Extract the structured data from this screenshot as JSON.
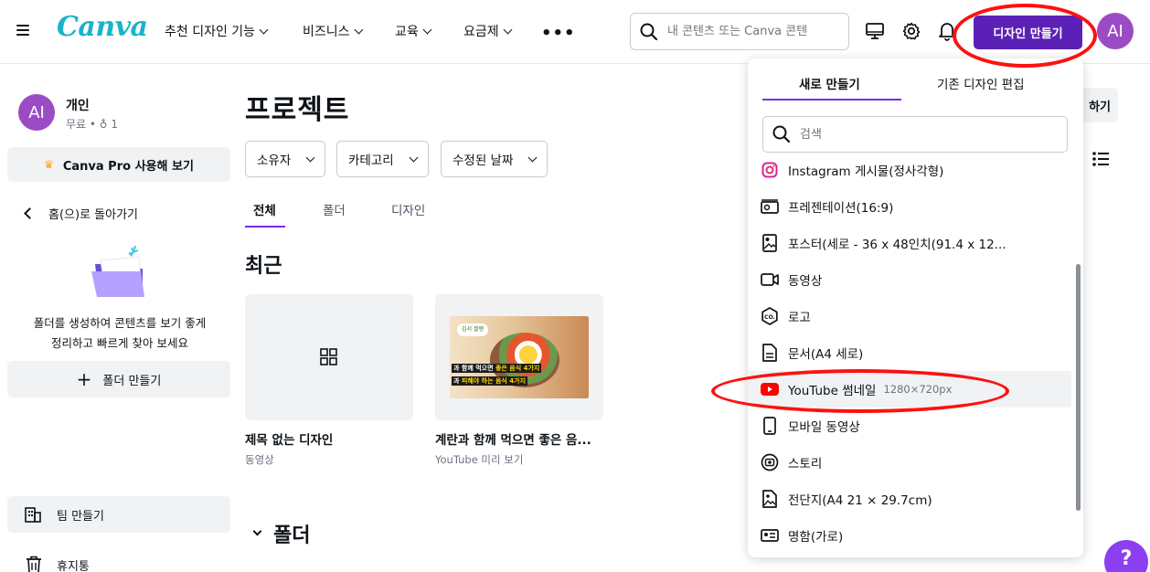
{
  "header": {
    "logo": "Canva",
    "nav": [
      {
        "label": "추천 디자인 기능"
      },
      {
        "label": "비즈니스"
      },
      {
        "label": "교육"
      },
      {
        "label": "요금제"
      }
    ],
    "search_placeholder": "내 콘텐츠 또는 Canva 콘텐",
    "create_button": "디자인 만들기",
    "avatar_initials": "AI"
  },
  "sidebar": {
    "profile": {
      "initials": "AI",
      "name": "개인",
      "plan": "무료 • ",
      "members": "1"
    },
    "pro_button": "Canva Pro 사용해 보기",
    "back_link": "홈(으)로 돌아가기",
    "folder_desc_line1": "폴더를 생성하여 콘텐츠를 보기 좋게",
    "folder_desc_line2": "정리하고 빠르게 찾아 보세요",
    "create_folder": "폴더 만들기",
    "create_team": "팀 만들기",
    "trash": "휴지통"
  },
  "main": {
    "title": "프로젝트",
    "filters": [
      "소유자",
      "카테고리",
      "수정된 날짜"
    ],
    "tabs": [
      "전체",
      "폴더",
      "디자인"
    ],
    "recent_title": "최근",
    "folders_title": "폴더",
    "share_button_partial": "하기",
    "cards": [
      {
        "title": "제목 없는 디자인",
        "subtitle": "동영상"
      },
      {
        "title": "계란과 함께 먹으면 좋은 음...",
        "subtitle": "YouTube 미리 보기",
        "thumb_badge": "김서 셀렝",
        "thumb_line1a": "과 함께 먹으면 ",
        "thumb_line1b": "좋은 음식 4가지",
        "thumb_line2a": "과 ",
        "thumb_line2b": "피해야 하는 음식 4가지"
      }
    ]
  },
  "dropdown": {
    "tabs": [
      "새로 만들기",
      "기존 디자인 편집"
    ],
    "search_placeholder": "검색",
    "items": [
      {
        "label": "Instagram 게시물(정사각형)",
        "icon": "instagram-icon"
      },
      {
        "label": "프레젠테이션(16:9)",
        "icon": "presentation-icon"
      },
      {
        "label": "포스터(세로 - 36 x 48인치(91.4 x 12...",
        "icon": "poster-icon"
      },
      {
        "label": "동영상",
        "icon": "video-icon"
      },
      {
        "label": "로고",
        "icon": "logo-icon"
      },
      {
        "label": "문서(A4 세로)",
        "icon": "document-icon"
      },
      {
        "label": "YouTube 썸네일",
        "size": "1280×720px",
        "icon": "youtube-icon"
      },
      {
        "label": "모바일 동영상",
        "icon": "mobile-video-icon"
      },
      {
        "label": "스토리",
        "icon": "story-icon"
      },
      {
        "label": "전단지(A4 21 × 29.7cm)",
        "icon": "flyer-icon"
      },
      {
        "label": "명함(가로)",
        "icon": "business-card-icon"
      }
    ]
  },
  "help_button": "?",
  "colors": {
    "brand_purple": "#5b21b6",
    "accent": "#7d2ae8",
    "annotation_red": "#ff1010",
    "avatar": "#9b4bc3"
  }
}
